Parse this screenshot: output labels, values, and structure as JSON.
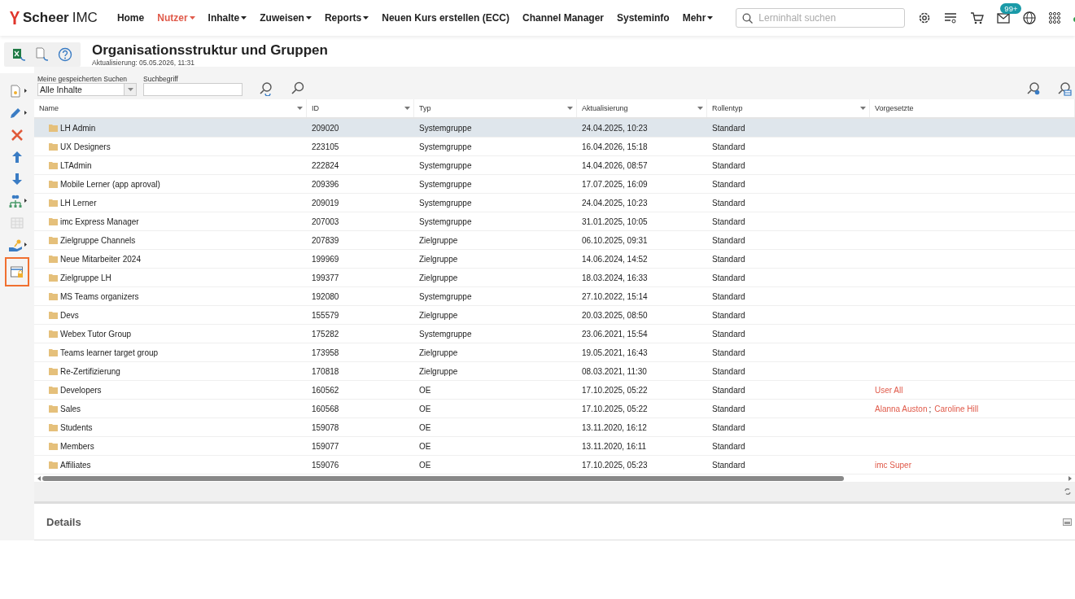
{
  "brand": {
    "name": "Scheer",
    "suffix": "IMC"
  },
  "nav": [
    {
      "label": "Home",
      "selected": false,
      "has_menu": false
    },
    {
      "label": "Nutzer",
      "selected": true,
      "has_menu": true
    },
    {
      "label": "Inhalte",
      "selected": false,
      "has_menu": true
    },
    {
      "label": "Zuweisen",
      "selected": false,
      "has_menu": true
    },
    {
      "label": "Reports",
      "selected": false,
      "has_menu": true
    },
    {
      "label": "Neuen Kurs erstellen (ECC)",
      "selected": false,
      "has_menu": false
    },
    {
      "label": "Channel Manager",
      "selected": false,
      "has_menu": false
    },
    {
      "label": "Systeminfo",
      "selected": false,
      "has_menu": false
    },
    {
      "label": "Mehr",
      "selected": false,
      "has_menu": true
    }
  ],
  "search": {
    "placeholder": "Lerninhalt suchen"
  },
  "mail_badge": "99+",
  "page": {
    "title": "Organisationsstruktur und Gruppen",
    "updated": "Aktualisierung: 05.05.2026, 11:31"
  },
  "filter": {
    "saved_label": "Meine gespeicherten Suchen",
    "saved_value": "Alle Inhalte",
    "term_label": "Suchbegriff"
  },
  "tools": [
    {
      "kind": "new",
      "has_menu": true,
      "selected": false,
      "disabled": false
    },
    {
      "kind": "edit",
      "has_menu": true,
      "selected": false,
      "disabled": false
    },
    {
      "kind": "delete",
      "has_menu": false,
      "selected": false,
      "disabled": false
    },
    {
      "kind": "up",
      "has_menu": false,
      "selected": false,
      "disabled": false
    },
    {
      "kind": "down",
      "has_menu": false,
      "selected": false,
      "disabled": false
    },
    {
      "kind": "org",
      "has_menu": true,
      "selected": false,
      "disabled": false
    },
    {
      "kind": "table",
      "has_menu": false,
      "selected": false,
      "disabled": true
    },
    {
      "kind": "assign",
      "has_menu": true,
      "selected": false,
      "disabled": false
    },
    {
      "kind": "lock",
      "has_menu": false,
      "selected": true,
      "disabled": false
    }
  ],
  "table": {
    "columns": [
      {
        "label": "Name",
        "has_filter": true
      },
      {
        "label": "ID",
        "has_filter": true
      },
      {
        "label": "Typ",
        "has_filter": true
      },
      {
        "label": "Aktualisierung",
        "has_filter": true
      },
      {
        "label": "Rollentyp",
        "has_filter": true
      },
      {
        "label": "Vorgesetzte",
        "has_filter": false
      }
    ],
    "rows": [
      {
        "name": "LH Admin",
        "id": "209020",
        "type": "Systemgruppe",
        "updated": "24.04.2025, 10:23",
        "role": "Standard",
        "selected": true
      },
      {
        "name": "UX Designers",
        "id": "223105",
        "type": "Systemgruppe",
        "updated": "16.04.2026, 15:18",
        "role": "Standard",
        "selected": false
      },
      {
        "name": "LTAdmin",
        "id": "222824",
        "type": "Systemgruppe",
        "updated": "14.04.2026, 08:57",
        "role": "Standard",
        "selected": false
      },
      {
        "name": "Mobile Lerner (app aproval)",
        "id": "209396",
        "type": "Systemgruppe",
        "updated": "17.07.2025, 16:09",
        "role": "Standard",
        "selected": false
      },
      {
        "name": "LH Lerner",
        "id": "209019",
        "type": "Systemgruppe",
        "updated": "24.04.2025, 10:23",
        "role": "Standard",
        "selected": false
      },
      {
        "name": "imc Express Manager",
        "id": "207003",
        "type": "Systemgruppe",
        "updated": "31.01.2025, 10:05",
        "role": "Standard",
        "selected": false
      },
      {
        "name": "Zielgruppe Channels",
        "id": "207839",
        "type": "Zielgruppe",
        "updated": "06.10.2025, 09:31",
        "role": "Standard",
        "selected": false
      },
      {
        "name": "Neue Mitarbeiter 2024",
        "id": "199969",
        "type": "Zielgruppe",
        "updated": "14.06.2024, 14:52",
        "role": "Standard",
        "selected": false
      },
      {
        "name": "Zielgruppe LH",
        "id": "199377",
        "type": "Zielgruppe",
        "updated": "18.03.2024, 16:33",
        "role": "Standard",
        "selected": false
      },
      {
        "name": "MS Teams organizers",
        "id": "192080",
        "type": "Systemgruppe",
        "updated": "27.10.2022, 15:14",
        "role": "Standard",
        "selected": false
      },
      {
        "name": "Devs",
        "id": "155579",
        "type": "Zielgruppe",
        "updated": "20.03.2025, 08:50",
        "role": "Standard",
        "selected": false
      },
      {
        "name": "Webex Tutor Group",
        "id": "175282",
        "type": "Systemgruppe",
        "updated": "23.06.2021, 15:54",
        "role": "Standard",
        "selected": false
      },
      {
        "name": "Teams learner target group",
        "id": "173958",
        "type": "Zielgruppe",
        "updated": "19.05.2021, 16:43",
        "role": "Standard",
        "selected": false
      },
      {
        "name": "Re-Zertifizierung",
        "id": "170818",
        "type": "Zielgruppe",
        "updated": "08.03.2021, 11:30",
        "role": "Standard",
        "selected": false
      },
      {
        "name": "Developers",
        "id": "160562",
        "type": "OE",
        "updated": "17.10.2025, 05:22",
        "role": "Standard",
        "selected": false,
        "supervisors": [
          {
            "kind": "link",
            "text": "User All"
          }
        ]
      },
      {
        "name": "Sales",
        "id": "160568",
        "type": "OE",
        "updated": "17.10.2025, 05:22",
        "role": "Standard",
        "selected": false,
        "supervisors": [
          {
            "kind": "link",
            "text": "Alanna Auston"
          },
          {
            "kind": "sep",
            "text": ";"
          },
          {
            "kind": "link",
            "text": "Caroline Hill"
          }
        ]
      },
      {
        "name": "Students",
        "id": "159078",
        "type": "OE",
        "updated": "13.11.2020, 16:12",
        "role": "Standard",
        "selected": false
      },
      {
        "name": "Members",
        "id": "159077",
        "type": "OE",
        "updated": "13.11.2020, 16:11",
        "role": "Standard",
        "selected": false
      },
      {
        "name": "Affiliates",
        "id": "159076",
        "type": "OE",
        "updated": "17.10.2025, 05:23",
        "role": "Standard",
        "selected": false,
        "supervisors": [
          {
            "kind": "link",
            "text": "imc Super"
          }
        ]
      }
    ]
  },
  "details": {
    "title": "Details"
  }
}
